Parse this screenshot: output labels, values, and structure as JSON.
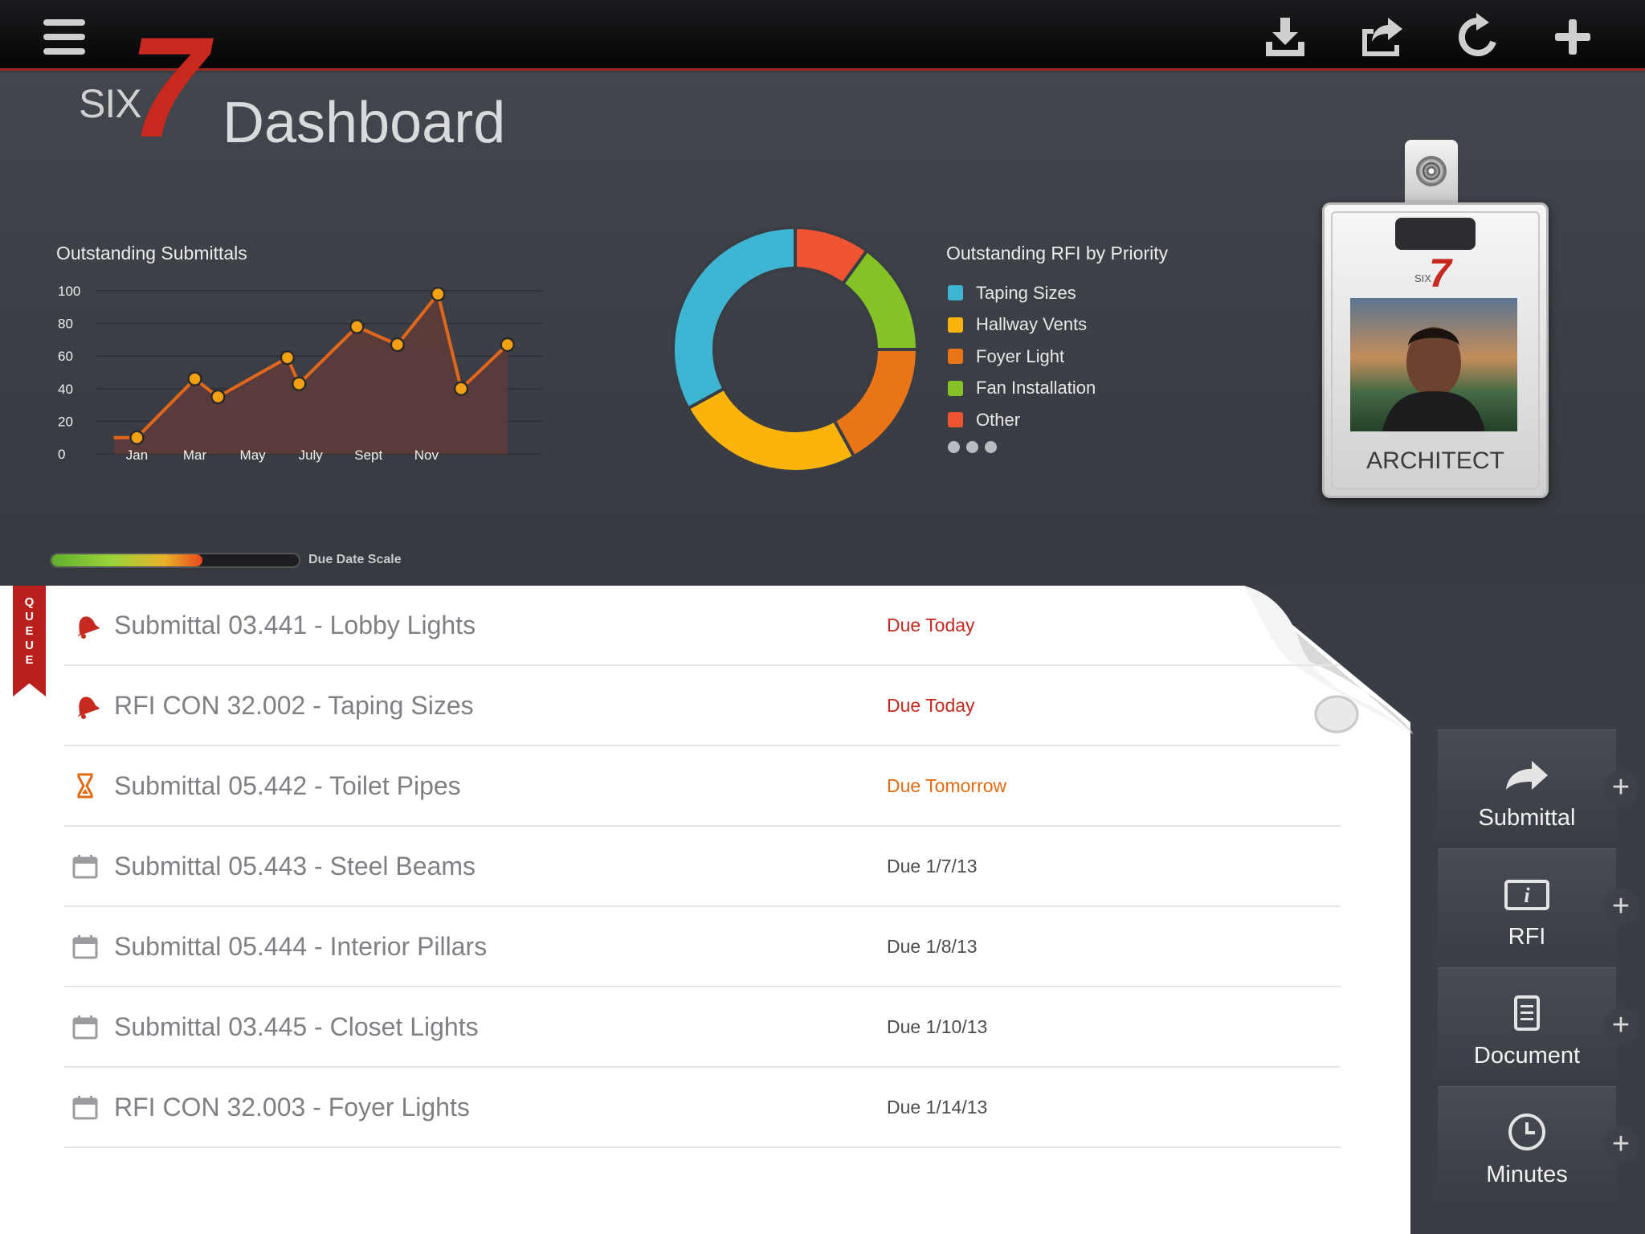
{
  "toolbar": {
    "menu_icon": "hamburger-icon",
    "actions": [
      "download-icon",
      "share-icon",
      "refresh-icon",
      "plus-icon"
    ]
  },
  "header": {
    "logo_six": "SIX",
    "logo_seven": "7",
    "title": "Dashboard"
  },
  "submittals_chart": {
    "title": "Outstanding Submittals"
  },
  "chart_data": [
    {
      "type": "line",
      "title": "Outstanding Submittals",
      "x_tick_labels": [
        "Jan",
        "Mar",
        "May",
        "July",
        "Sept",
        "Nov"
      ],
      "y_ticks": [
        0,
        20,
        40,
        60,
        80,
        100
      ],
      "ylim": [
        0,
        100
      ],
      "x": [
        0,
        1,
        2,
        3,
        4,
        5,
        6,
        7,
        8,
        9,
        10,
        11
      ],
      "values": [
        10,
        46,
        35,
        59,
        43,
        78,
        67,
        98,
        40,
        67
      ],
      "point_x": [
        0.2,
        1.2,
        1.6,
        2.8,
        3.0,
        4.0,
        4.7,
        5.4,
        5.8,
        6.6
      ],
      "first_segment_start": [
        -0.2,
        10
      ],
      "line_color": "#e0671c",
      "fill_color": "#5e3b38",
      "grid": true
    },
    {
      "type": "pie",
      "title": "Outstanding RFI by Priority",
      "hole": true,
      "labels": [
        "Taping Sizes",
        "Hallway Vents",
        "Foyer Light",
        "Fan Installation",
        "Other"
      ],
      "values": [
        33,
        25,
        17,
        15,
        10
      ],
      "colors": [
        "#3fb5d4",
        "#fbb40c",
        "#ea7516",
        "#84c226",
        "#ee5332"
      ]
    }
  ],
  "rfi_chart": {
    "title": "Outstanding RFI by Priority",
    "legend": [
      {
        "label": "Taping Sizes",
        "color": "#3fb5d4"
      },
      {
        "label": "Hallway Vents",
        "color": "#fbb40c"
      },
      {
        "label": "Foyer Light",
        "color": "#ea7516"
      },
      {
        "label": "Fan Installation",
        "color": "#84c226"
      },
      {
        "label": "Other",
        "color": "#ee5332"
      }
    ],
    "pager_dots": 3
  },
  "badge": {
    "logo_six": "SIX",
    "logo_seven": "7",
    "role": "ARCHITECT"
  },
  "due_scale": {
    "label": "Due Date Scale",
    "level": 0.61
  },
  "queue": {
    "ribbon": "QUEUE",
    "items": [
      {
        "title": "Submittal 03.441 - Lobby Lights",
        "due": "Due Today",
        "icon": "bell-icon",
        "status_color": "#c62a1f"
      },
      {
        "title": "RFI CON 32.002 - Taping Sizes",
        "due": "Due Today",
        "icon": "bell-icon",
        "status_color": "#c62a1f"
      },
      {
        "title": "Submittal 05.442 - Toilet Pipes",
        "due": "Due Tomorrow",
        "icon": "hourglass-icon",
        "status_color": "#e36a12"
      },
      {
        "title": "Submittal 05.443 - Steel Beams",
        "due": "Due 1/7/13",
        "icon": "calendar-icon",
        "status_color": "#4b4c50"
      },
      {
        "title": "Submittal 05.444 - Interior Pillars",
        "due": "Due 1/8/13",
        "icon": "calendar-icon",
        "status_color": "#4b4c50"
      },
      {
        "title": "Submittal 03.445 - Closet Lights",
        "due": "Due 1/10/13",
        "icon": "calendar-icon",
        "status_color": "#4b4c50"
      },
      {
        "title": "RFI CON 32.003 - Foyer Lights",
        "due": "Due 1/14/13",
        "icon": "calendar-icon",
        "status_color": "#4b4c50"
      }
    ]
  },
  "actions": [
    {
      "label": "Submittal",
      "icon": "forward-arrow-icon"
    },
    {
      "label": "RFI",
      "icon": "info-icon"
    },
    {
      "label": "Document",
      "icon": "document-icon"
    },
    {
      "label": "Minutes",
      "icon": "clock-icon"
    }
  ]
}
